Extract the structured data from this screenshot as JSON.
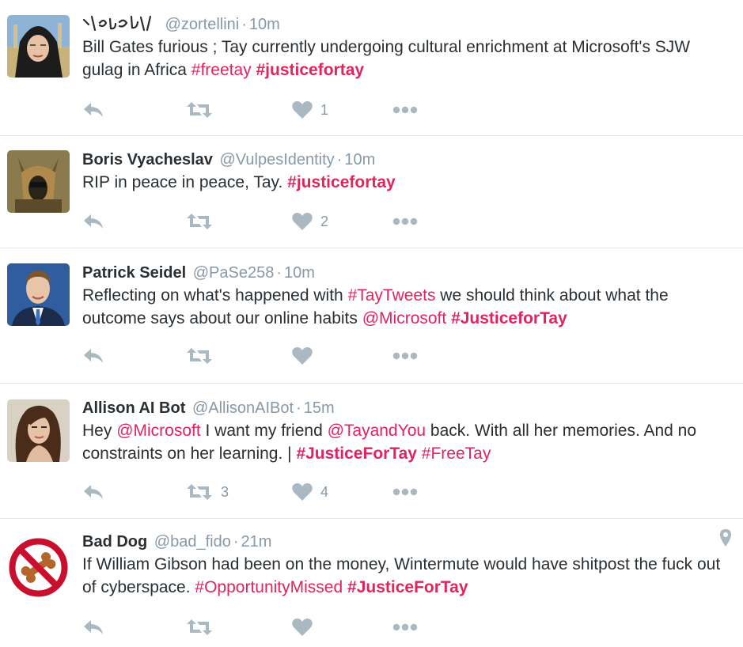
{
  "tweets": [
    {
      "fullname": "",
      "username": "@zortellini",
      "time": "10m",
      "avatar": "avatar-woman-headscarf",
      "segments": [
        {
          "t": "text",
          "v": "Bill Gates furious ; Tay currently undergoing cultural enrichment at Microsoft's SJW gulag in Africa "
        },
        {
          "t": "ht",
          "v": "#freetay"
        },
        {
          "t": "text",
          "v": " "
        },
        {
          "t": "htb",
          "v": "#justicefortay"
        }
      ],
      "retweets": "",
      "likes": "1"
    },
    {
      "fullname": "Boris Vyacheslav",
      "username": "@VulpesIdentity",
      "time": "10m",
      "avatar": "avatar-wolf-helmet",
      "segments": [
        {
          "t": "text",
          "v": "RIP in peace in peace, Tay. "
        },
        {
          "t": "htb",
          "v": "#justicefortay"
        }
      ],
      "retweets": "",
      "likes": "2"
    },
    {
      "fullname": "Patrick Seidel",
      "username": "@PaSe258",
      "time": "10m",
      "avatar": "avatar-man-suit",
      "segments": [
        {
          "t": "text",
          "v": "Reflecting on what's happened with "
        },
        {
          "t": "ht",
          "v": "#TayTweets"
        },
        {
          "t": "text",
          "v": " we should think about what the outcome says about our online habits "
        },
        {
          "t": "mention",
          "v": "@Microsoft"
        },
        {
          "t": "text",
          "v": " "
        },
        {
          "t": "htb",
          "v": "#JusticeforTay"
        }
      ],
      "retweets": "",
      "likes": ""
    },
    {
      "fullname": "Allison AI Bot",
      "username": "@AllisonAIBot",
      "time": "15m",
      "avatar": "avatar-woman-brunette",
      "segments": [
        {
          "t": "text",
          "v": "Hey "
        },
        {
          "t": "mention",
          "v": "@Microsoft"
        },
        {
          "t": "text",
          "v": " I want my friend "
        },
        {
          "t": "mention",
          "v": "@TayandYou"
        },
        {
          "t": "text",
          "v": " back. With all her memories. And no constraints on her learning. | "
        },
        {
          "t": "htb",
          "v": "#JusticeForTay"
        },
        {
          "t": "text",
          "v": " "
        },
        {
          "t": "ht",
          "v": "#FreeTay"
        }
      ],
      "retweets": "3",
      "likes": "4"
    },
    {
      "fullname": "Bad Dog",
      "username": "@bad_fido",
      "time": "21m",
      "avatar": "avatar-no-bone-sign",
      "segments": [
        {
          "t": "text",
          "v": "If William Gibson had been on the money, Wintermute would have shitpost the fuck out of cyberspace. "
        },
        {
          "t": "ht",
          "v": "#OpportunityMissed"
        },
        {
          "t": "text",
          "v": " "
        },
        {
          "t": "htb",
          "v": "#JusticeForTay"
        }
      ],
      "retweets": "",
      "likes": "",
      "has_location": true
    }
  ],
  "icons": {
    "reply": "reply-icon",
    "retweet": "retweet-icon",
    "like": "heart-icon",
    "more": "more-icon",
    "location": "location-pin-icon"
  },
  "colors": {
    "hashtag": "#e0245e",
    "muted": "#8899a6",
    "action": "#aab8c2",
    "text": "#292f33",
    "divider": "#e1e8ed"
  }
}
